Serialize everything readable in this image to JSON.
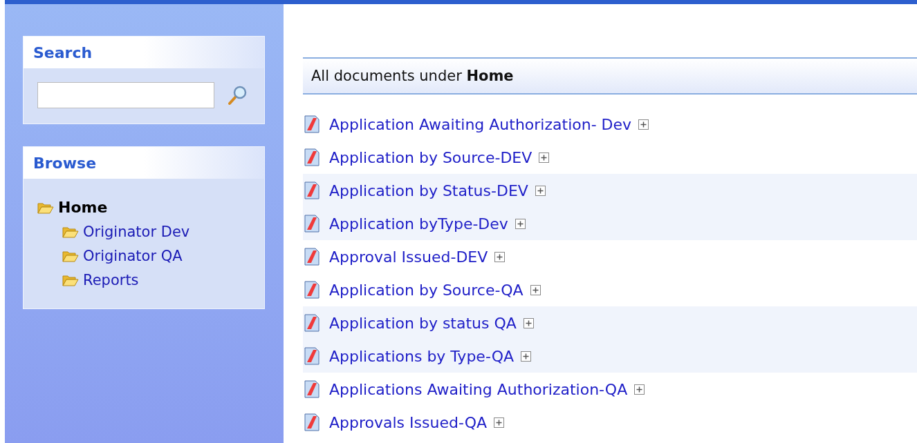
{
  "sidebar": {
    "search": {
      "title": "Search"
    },
    "browse": {
      "title": "Browse",
      "tree": [
        {
          "label": "Home",
          "selected": true,
          "children": [
            {
              "label": "Originator Dev",
              "selected": false
            },
            {
              "label": "Originator QA",
              "selected": false
            },
            {
              "label": "Reports",
              "selected": false
            }
          ]
        }
      ]
    }
  },
  "main": {
    "heading": "All documents under **Home**",
    "documents": [
      {
        "title": "Application Awaiting Authorization- Dev",
        "expanded": false
      },
      {
        "title": "Application by Source-DEV",
        "expanded": false
      },
      {
        "title": "Application by Status-DEV",
        "expanded": false
      },
      {
        "title": "Application byType-Dev",
        "expanded": false
      },
      {
        "title": "Approval Issued-DEV",
        "expanded": false
      },
      {
        "title": "Application by Source-QA",
        "expanded": false
      },
      {
        "title": "Application by status QA",
        "expanded": false
      },
      {
        "title": "Applications by Type-QA",
        "expanded": false
      },
      {
        "title": "Applications Awaiting Authorization-QA",
        "expanded": false
      },
      {
        "title": "Approvals Issued-QA",
        "expanded": false
      }
    ]
  }
}
